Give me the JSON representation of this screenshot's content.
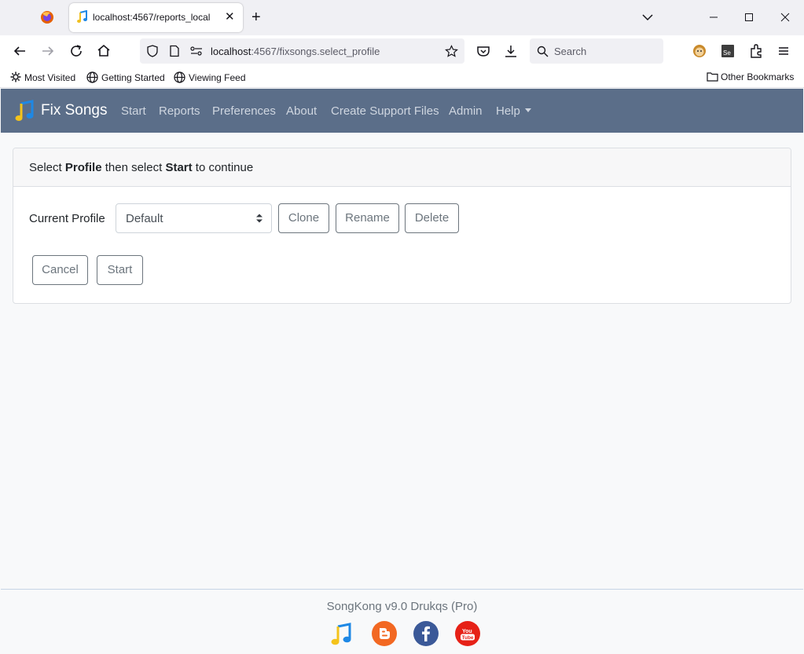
{
  "browser": {
    "tab": {
      "title": "localhost:4567/reports_local",
      "close": "✕"
    },
    "new_tab": "+",
    "url": {
      "host": "localhost",
      "rest": ":4567/fixsongs.select_profile"
    },
    "search_placeholder": "Search",
    "bookmarks": [
      "Most Visited",
      "Getting Started",
      "Viewing Feed"
    ],
    "other_bookmarks": "Other Bookmarks"
  },
  "app": {
    "brand": "Fix Songs",
    "nav": [
      "Start",
      "Reports",
      "Preferences",
      "About",
      "Create Support Files",
      "Admin",
      "Help"
    ],
    "accent": "#5b6e89"
  },
  "card": {
    "header": {
      "before": "Select ",
      "profile": "Profile",
      "middle": " then select ",
      "start": "Start",
      "after": " to continue"
    },
    "profile_label": "Current Profile",
    "profile_value": "Default",
    "buttons": {
      "clone": "Clone",
      "rename": "Rename",
      "delete": "Delete",
      "cancel": "Cancel",
      "start": "Start"
    }
  },
  "footer": {
    "version": "SongKong v9.0 Drukqs (Pro)",
    "social": [
      "songkong-icon",
      "blogger-icon",
      "facebook-icon",
      "youtube-icon"
    ]
  }
}
